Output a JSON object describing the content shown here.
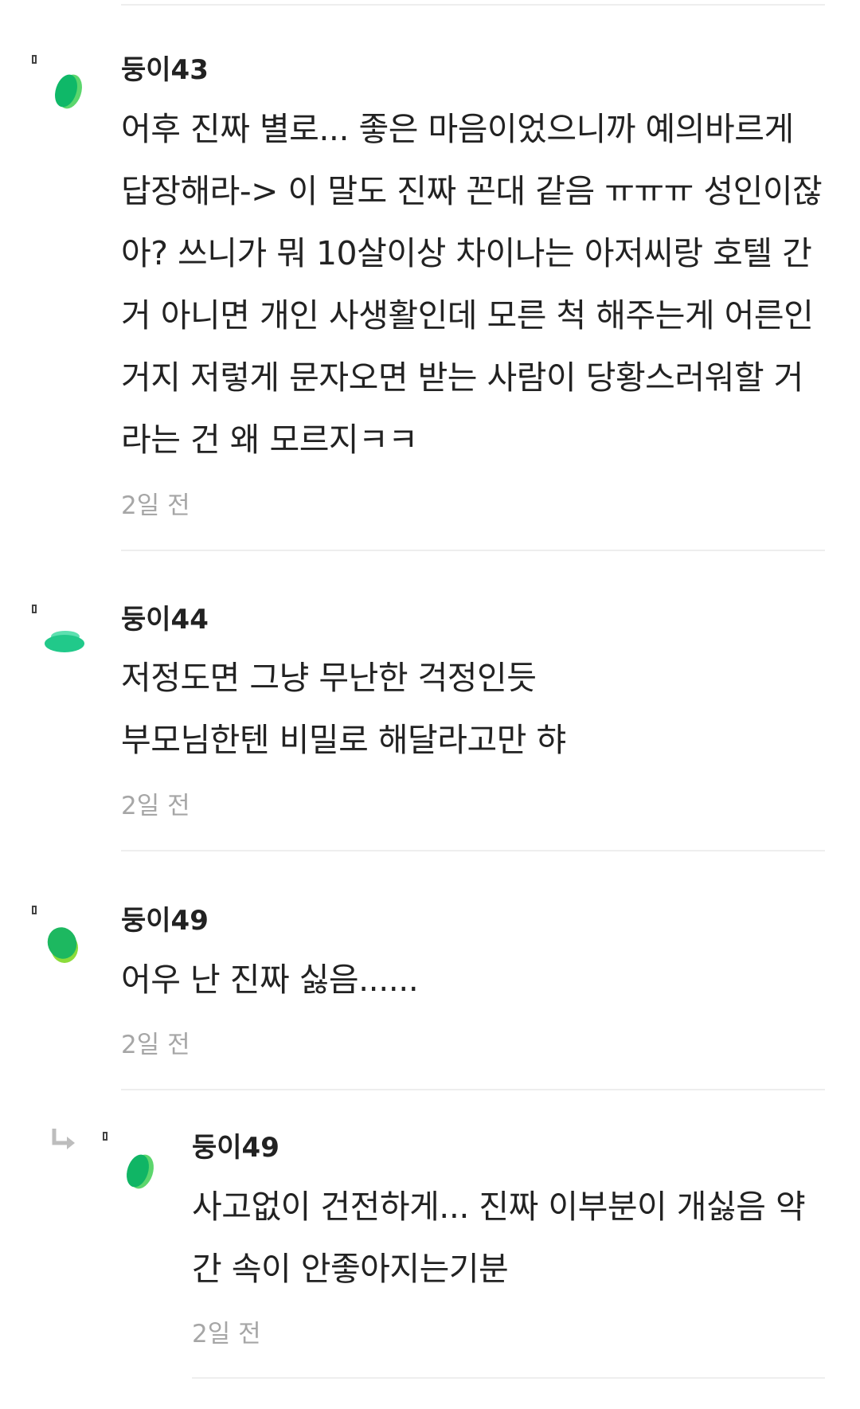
{
  "comments": [
    {
      "author": "둥이43",
      "lines": [
        "어후 진짜 별로... 좋은 마음이었으니까 예의바르게",
        "답장해라-> 이 말도 진짜 꼰대 같음 ㅠㅠㅠ 성인이잖",
        "아? 쓰니가 뭐 10살이상 차이나는 아저씨랑 호텔 간",
        "거 아니면 개인 사생활인데 모른 척 해주는게 어른인",
        "거지 저렇게 문자오면 받는 사람이 당황스러워할 거",
        "라는 건 왜 모르지ㅋㅋ"
      ],
      "time": "2일 전",
      "avatar_colors": [
        "#0fb868",
        "#5cd66d"
      ]
    },
    {
      "author": "둥이44",
      "lines": [
        "저정도면 그냥 무난한 걱정인듯",
        "부모님한텐 비밀로 해달라고만 햐"
      ],
      "time": "2일 전",
      "avatar_colors": [
        "#21c98a",
        "#5de0b0"
      ]
    },
    {
      "author": "둥이49",
      "lines": [
        "어우 난 진짜 싫음......"
      ],
      "time": "2일 전",
      "avatar_colors": [
        "#1db860",
        "#8bdc3a"
      ]
    },
    {
      "author": "둥이49",
      "is_reply": true,
      "lines": [
        "사고없이 건전하게... 진짜 이부분이 개싫음 약",
        "간 속이 안좋아지는기분"
      ],
      "time": "2일 전",
      "avatar_colors": [
        "#10b565",
        "#5cd66d"
      ]
    }
  ],
  "icons": {
    "avatar": "leaf-avatar-icon",
    "marker": "square-marker-icon",
    "reply": "reply-arrow-icon"
  }
}
